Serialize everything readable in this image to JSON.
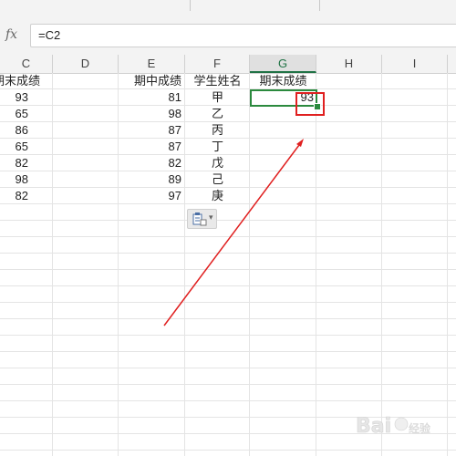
{
  "formula_bar": {
    "fx_label": "fx",
    "formula": "=C2"
  },
  "columns": [
    {
      "letter": "C",
      "active": false
    },
    {
      "letter": "D",
      "active": false
    },
    {
      "letter": "E",
      "active": false
    },
    {
      "letter": "F",
      "active": false
    },
    {
      "letter": "G",
      "active": true
    },
    {
      "letter": "H",
      "active": false
    },
    {
      "letter": "I",
      "active": false
    }
  ],
  "headers": {
    "c": "期末成绩",
    "e": "期中成绩",
    "f": "学生姓名",
    "g": "期末成绩"
  },
  "rows": [
    {
      "c": "93",
      "e": "81",
      "f": "甲",
      "g": "93"
    },
    {
      "c": "65",
      "e": "98",
      "f": "乙",
      "g": ""
    },
    {
      "c": "86",
      "e": "87",
      "f": "丙",
      "g": ""
    },
    {
      "c": "65",
      "e": "87",
      "f": "丁",
      "g": ""
    },
    {
      "c": "82",
      "e": "82",
      "f": "戊",
      "g": ""
    },
    {
      "c": "98",
      "e": "89",
      "f": "己",
      "g": ""
    },
    {
      "c": "82",
      "e": "97",
      "f": "庚",
      "g": ""
    }
  ],
  "paste_options": {
    "icon": "paste-options-icon",
    "caret": "▾"
  },
  "annotation": {
    "color": "#e02020"
  },
  "watermark": "Bai du 经验"
}
